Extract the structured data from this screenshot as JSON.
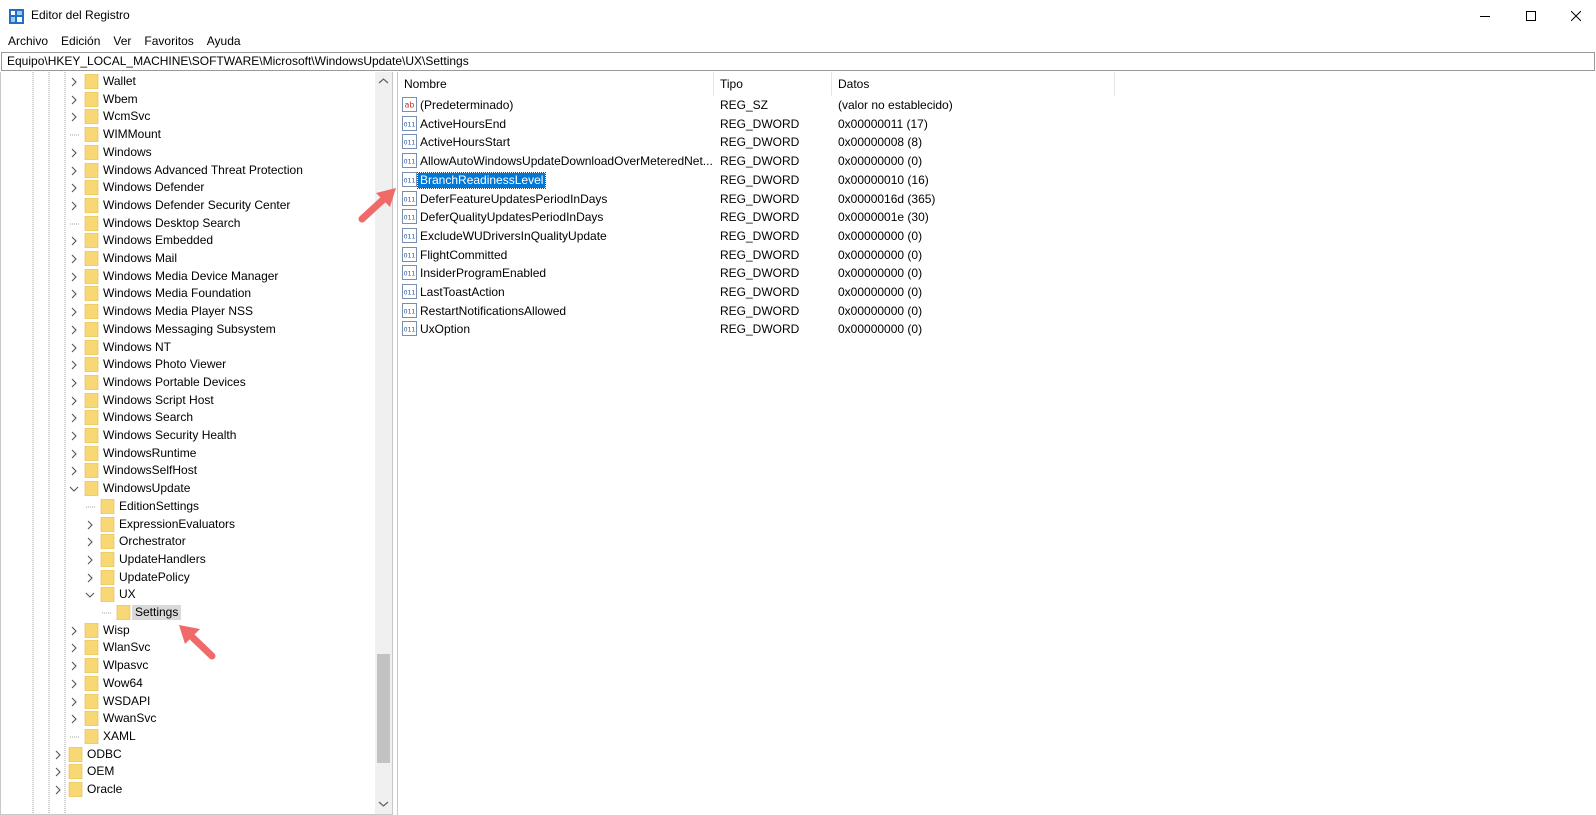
{
  "window": {
    "title": "Editor del Registro",
    "icon": "regedit-icon",
    "controls": [
      "minimize-icon",
      "maximize-icon",
      "close-icon"
    ]
  },
  "menu": [
    "Archivo",
    "Edición",
    "Ver",
    "Favoritos",
    "Ayuda"
  ],
  "address": "Equipo\\HKEY_LOCAL_MACHINE\\SOFTWARE\\Microsoft\\WindowsUpdate\\UX\\Settings",
  "tree": [
    {
      "label": "Wallet",
      "level": 2,
      "expander": "collapsed"
    },
    {
      "label": "Wbem",
      "level": 2,
      "expander": "collapsed"
    },
    {
      "label": "WcmSvc",
      "level": 2,
      "expander": "collapsed"
    },
    {
      "label": "WIMMount",
      "level": 2,
      "expander": "none"
    },
    {
      "label": "Windows",
      "level": 2,
      "expander": "collapsed"
    },
    {
      "label": "Windows Advanced Threat Protection",
      "level": 2,
      "expander": "collapsed"
    },
    {
      "label": "Windows Defender",
      "level": 2,
      "expander": "collapsed"
    },
    {
      "label": "Windows Defender Security Center",
      "level": 2,
      "expander": "collapsed"
    },
    {
      "label": "Windows Desktop Search",
      "level": 2,
      "expander": "none"
    },
    {
      "label": "Windows Embedded",
      "level": 2,
      "expander": "collapsed"
    },
    {
      "label": "Windows Mail",
      "level": 2,
      "expander": "collapsed"
    },
    {
      "label": "Windows Media Device Manager",
      "level": 2,
      "expander": "collapsed"
    },
    {
      "label": "Windows Media Foundation",
      "level": 2,
      "expander": "collapsed"
    },
    {
      "label": "Windows Media Player NSS",
      "level": 2,
      "expander": "collapsed"
    },
    {
      "label": "Windows Messaging Subsystem",
      "level": 2,
      "expander": "collapsed"
    },
    {
      "label": "Windows NT",
      "level": 2,
      "expander": "collapsed"
    },
    {
      "label": "Windows Photo Viewer",
      "level": 2,
      "expander": "collapsed"
    },
    {
      "label": "Windows Portable Devices",
      "level": 2,
      "expander": "collapsed"
    },
    {
      "label": "Windows Script Host",
      "level": 2,
      "expander": "collapsed"
    },
    {
      "label": "Windows Search",
      "level": 2,
      "expander": "collapsed"
    },
    {
      "label": "Windows Security Health",
      "level": 2,
      "expander": "collapsed"
    },
    {
      "label": "WindowsRuntime",
      "level": 2,
      "expander": "collapsed"
    },
    {
      "label": "WindowsSelfHost",
      "level": 2,
      "expander": "collapsed"
    },
    {
      "label": "WindowsUpdate",
      "level": 2,
      "expander": "expanded"
    },
    {
      "label": "EditionSettings",
      "level": 3,
      "expander": "none"
    },
    {
      "label": "ExpressionEvaluators",
      "level": 3,
      "expander": "collapsed"
    },
    {
      "label": "Orchestrator",
      "level": 3,
      "expander": "collapsed"
    },
    {
      "label": "UpdateHandlers",
      "level": 3,
      "expander": "collapsed"
    },
    {
      "label": "UpdatePolicy",
      "level": 3,
      "expander": "collapsed"
    },
    {
      "label": "UX",
      "level": 3,
      "expander": "expanded"
    },
    {
      "label": "Settings",
      "level": 4,
      "expander": "none",
      "selected": true
    },
    {
      "label": "Wisp",
      "level": 2,
      "expander": "collapsed"
    },
    {
      "label": "WlanSvc",
      "level": 2,
      "expander": "collapsed"
    },
    {
      "label": "Wlpasvc",
      "level": 2,
      "expander": "collapsed"
    },
    {
      "label": "Wow64",
      "level": 2,
      "expander": "collapsed"
    },
    {
      "label": "WSDAPI",
      "level": 2,
      "expander": "collapsed"
    },
    {
      "label": "WwanSvc",
      "level": 2,
      "expander": "collapsed"
    },
    {
      "label": "XAML",
      "level": 2,
      "expander": "none"
    },
    {
      "label": "ODBC",
      "level": 1,
      "expander": "collapsed"
    },
    {
      "label": "OEM",
      "level": 1,
      "expander": "collapsed"
    },
    {
      "label": "Oracle",
      "level": 1,
      "expander": "collapsed"
    }
  ],
  "list": {
    "headers": {
      "name": "Nombre",
      "type": "Tipo",
      "data": "Datos"
    },
    "rows": [
      {
        "name": "(Predeterminado)",
        "type": "REG_SZ",
        "data": "(valor no establecido)",
        "icon": "string-value-icon"
      },
      {
        "name": "ActiveHoursEnd",
        "type": "REG_DWORD",
        "data": "0x00000011 (17)",
        "icon": "binary-value-icon"
      },
      {
        "name": "ActiveHoursStart",
        "type": "REG_DWORD",
        "data": "0x00000008 (8)",
        "icon": "binary-value-icon"
      },
      {
        "name": "AllowAutoWindowsUpdateDownloadOverMeteredNet...",
        "type": "REG_DWORD",
        "data": "0x00000000 (0)",
        "icon": "binary-value-icon"
      },
      {
        "name": "BranchReadinessLevel",
        "type": "REG_DWORD",
        "data": "0x00000010 (16)",
        "icon": "binary-value-icon",
        "selected": true
      },
      {
        "name": "DeferFeatureUpdatesPeriodInDays",
        "type": "REG_DWORD",
        "data": "0x0000016d (365)",
        "icon": "binary-value-icon"
      },
      {
        "name": "DeferQualityUpdatesPeriodInDays",
        "type": "REG_DWORD",
        "data": "0x0000001e (30)",
        "icon": "binary-value-icon"
      },
      {
        "name": "ExcludeWUDriversInQualityUpdate",
        "type": "REG_DWORD",
        "data": "0x00000000 (0)",
        "icon": "binary-value-icon"
      },
      {
        "name": "FlightCommitted",
        "type": "REG_DWORD",
        "data": "0x00000000 (0)",
        "icon": "binary-value-icon"
      },
      {
        "name": "InsiderProgramEnabled",
        "type": "REG_DWORD",
        "data": "0x00000000 (0)",
        "icon": "binary-value-icon"
      },
      {
        "name": "LastToastAction",
        "type": "REG_DWORD",
        "data": "0x00000000 (0)",
        "icon": "binary-value-icon"
      },
      {
        "name": "RestartNotificationsAllowed",
        "type": "REG_DWORD",
        "data": "0x00000000 (0)",
        "icon": "binary-value-icon"
      },
      {
        "name": "UxOption",
        "type": "REG_DWORD",
        "data": "0x00000000 (0)",
        "icon": "binary-value-icon"
      }
    ]
  },
  "colors": {
    "selection": "#0078d7",
    "tree_selection": "#d9d9d9",
    "folder": "#f8d775",
    "annotation_arrow": "#f06a6a"
  }
}
